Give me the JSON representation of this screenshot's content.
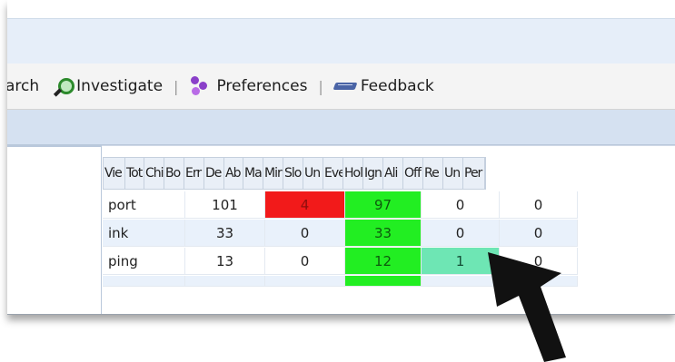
{
  "toolbar": {
    "search_label": "arch",
    "investigate_label": "Investigate",
    "preferences_label": "Preferences",
    "feedback_label": "Feedback",
    "separator": "|"
  },
  "grid": {
    "columns": [
      "Vie",
      "Tot",
      "Chi",
      "Bo",
      "Err",
      "De",
      "Ab",
      "Ma",
      "Mir",
      "Slo",
      "Un",
      "Eve",
      "Hol",
      "Ign",
      "Ali",
      "Off",
      "Re",
      "Un",
      "Per"
    ],
    "rows": [
      {
        "name": "port",
        "a": "101",
        "b": "4",
        "c": "97",
        "d": "0",
        "e": "0"
      },
      {
        "name": "ink",
        "a": "33",
        "b": "0",
        "c": "33",
        "d": "0",
        "e": "0"
      },
      {
        "name": "ping",
        "a": "13",
        "b": "0",
        "c": "12",
        "d": "1",
        "e": "0"
      }
    ]
  },
  "colors": {
    "critical": "#f21a1a",
    "ok": "#22ee22",
    "info": "#6ee6b4",
    "arrow": "#111111"
  }
}
